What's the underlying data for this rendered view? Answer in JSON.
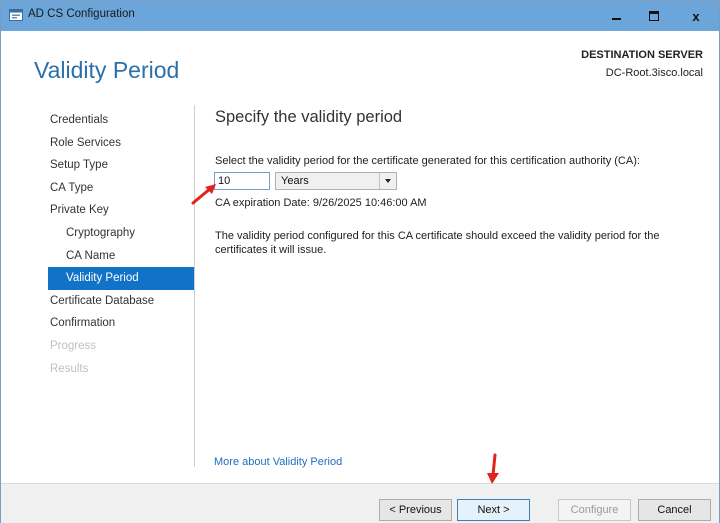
{
  "window": {
    "title": "AD CS Configuration",
    "controls": {
      "minimize": "minimize",
      "maximize": "maximize",
      "close": "x"
    }
  },
  "header": {
    "title": "Validity Period",
    "destination_label": "DESTINATION SERVER",
    "destination_server": "DC-Root.3isco.local"
  },
  "nav": {
    "items": [
      {
        "label": "Credentials",
        "state": "normal",
        "indent": false
      },
      {
        "label": "Role Services",
        "state": "normal",
        "indent": false
      },
      {
        "label": "Setup Type",
        "state": "normal",
        "indent": false
      },
      {
        "label": "CA Type",
        "state": "normal",
        "indent": false
      },
      {
        "label": "Private Key",
        "state": "normal",
        "indent": false
      },
      {
        "label": "Cryptography",
        "state": "normal",
        "indent": true
      },
      {
        "label": "CA Name",
        "state": "normal",
        "indent": true
      },
      {
        "label": "Validity Period",
        "state": "active",
        "indent": true
      },
      {
        "label": "Certificate Database",
        "state": "normal",
        "indent": false
      },
      {
        "label": "Confirmation",
        "state": "normal",
        "indent": false
      },
      {
        "label": "Progress",
        "state": "disabled",
        "indent": false
      },
      {
        "label": "Results",
        "state": "disabled",
        "indent": false
      }
    ]
  },
  "content": {
    "title": "Specify the validity period",
    "instruction": "Select the validity period for the certificate generated for this certification authority (CA):",
    "period_value": "10",
    "period_unit": "Years",
    "expiration": "CA expiration Date: 9/26/2025 10:46:00 AM",
    "note": "The validity period configured for this CA certificate should exceed the validity period for the certificates it will issue.",
    "more_link": "More about Validity Period"
  },
  "footer": {
    "previous": "< Previous",
    "next": "Next >",
    "configure": "Configure",
    "cancel": "Cancel"
  },
  "colors": {
    "titlebar": "#6ba5d9",
    "accent": "#2b6fab",
    "active_nav": "#1272c7",
    "link": "#1f6fc1",
    "annotation_arrow": "#e0231c"
  }
}
